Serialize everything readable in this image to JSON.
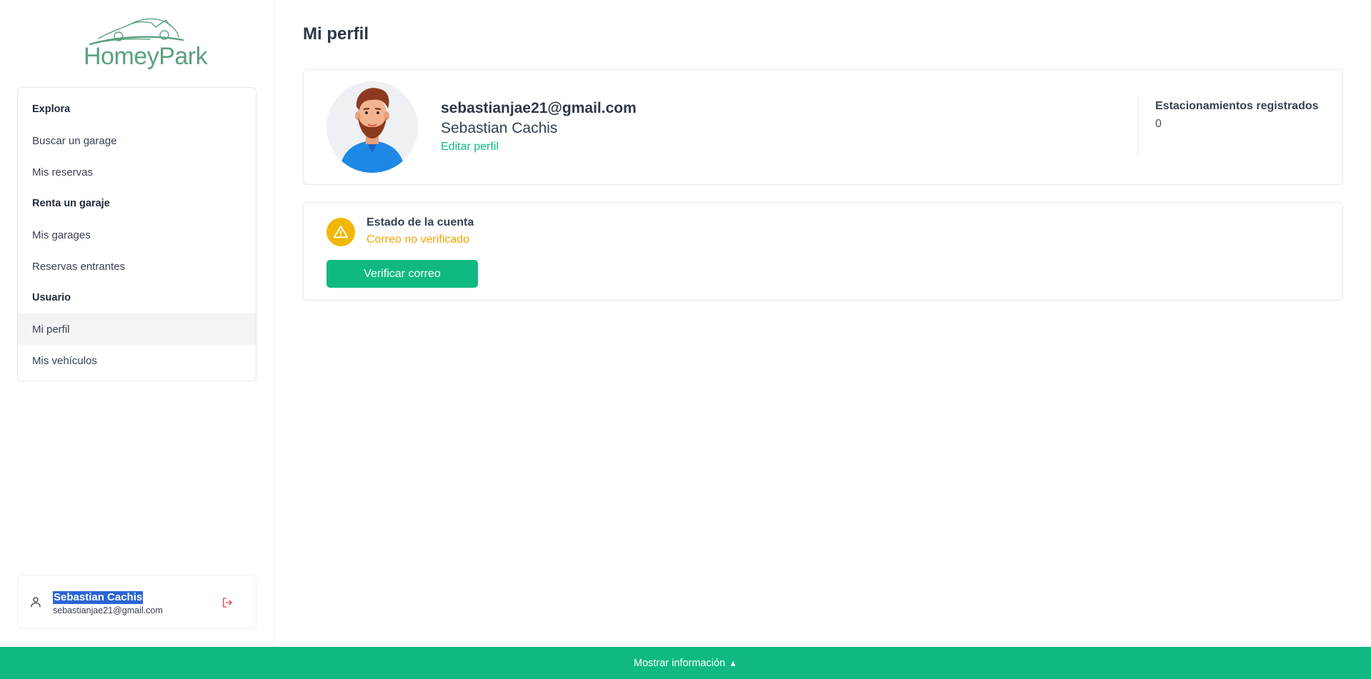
{
  "brand": {
    "name": "HomeyPark",
    "color": "#5aa17e"
  },
  "sidebar": {
    "groups": [
      {
        "heading": "Explora",
        "items": [
          "Buscar un garage",
          "Mis reservas"
        ]
      },
      {
        "heading": "Renta un garaje",
        "items": [
          "Mis garages",
          "Reservas entrantes"
        ]
      },
      {
        "heading": "Usuario",
        "items": [
          "Mi perfil",
          "Mis vehículos"
        ]
      }
    ],
    "active_item": "Mi perfil"
  },
  "user_card": {
    "name": "Sebastian Cachis",
    "email": "sebastianjae21@gmail.com",
    "icons": {
      "user": "user-icon",
      "logout": "logout-icon"
    }
  },
  "page": {
    "title": "Mi perfil"
  },
  "profile": {
    "email": "sebastianjae21@gmail.com",
    "name": "Sebastian Cachis",
    "edit_label": "Editar perfil",
    "stats_label": "Estacionamientos registrados",
    "stats_value": "0"
  },
  "account_status": {
    "title": "Estado de la cuenta",
    "value": "Correo no verificado",
    "button_label": "Verificar correo",
    "status_color": "#f0a500"
  },
  "bottom_bar": {
    "label": "Mostrar información",
    "caret": "▲"
  },
  "colors": {
    "accent": "#10b981",
    "warning": "#f2b705"
  }
}
